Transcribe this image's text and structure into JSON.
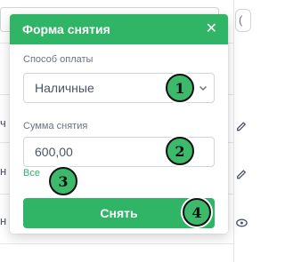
{
  "popup": {
    "title": "Форма снятия",
    "close_icon": "close-icon",
    "payment_method": {
      "label": "Способ оплаты",
      "value": "Наличные",
      "icon": "chevron-down-icon"
    },
    "amount": {
      "label": "Сумма снятия",
      "value": "600,00"
    },
    "all_link": "Все",
    "submit_label": "Снять"
  },
  "badges": [
    "1",
    "2",
    "3",
    "4"
  ],
  "background": {
    "row_letters": [
      "ч",
      "н",
      "н"
    ],
    "right_icons": [
      "pencil-icon",
      "pencil-icon",
      "eye-icon"
    ]
  },
  "colors": {
    "accent": "#2fb565",
    "badge": "#3cb96a"
  }
}
